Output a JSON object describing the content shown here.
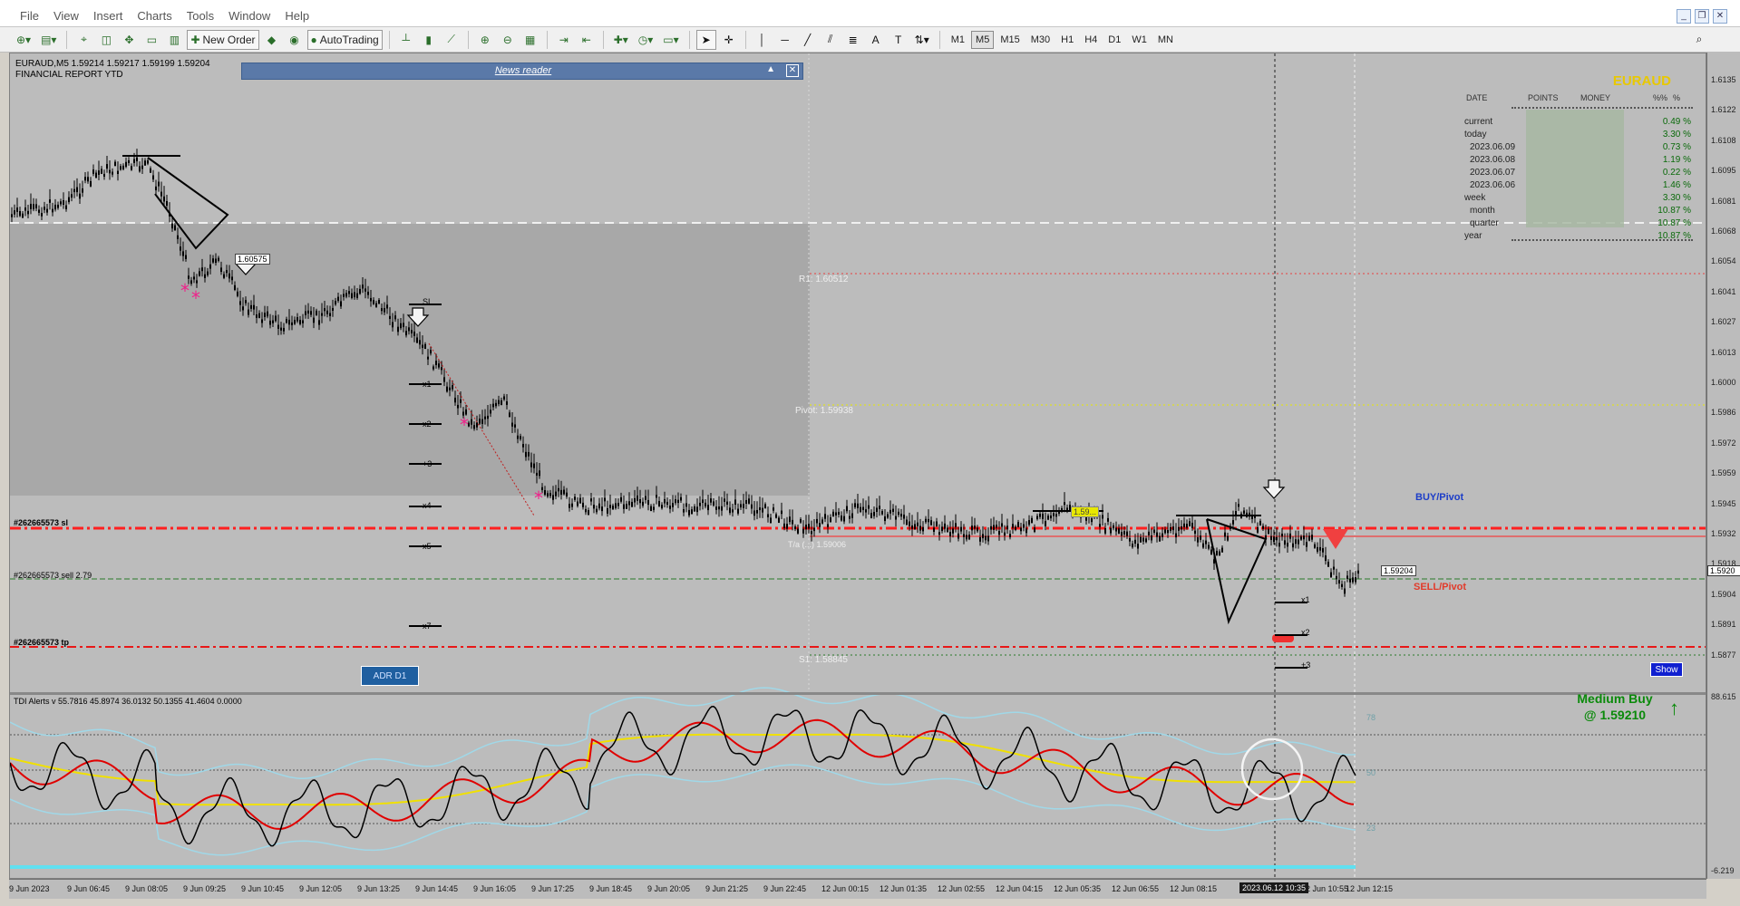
{
  "menu": [
    "File",
    "View",
    "Insert",
    "Charts",
    "Tools",
    "Window",
    "Help"
  ],
  "toolbar": {
    "new_order": "New Order",
    "autotrading": "AutoTrading",
    "timeframes": [
      "M1",
      "M5",
      "M15",
      "M30",
      "H1",
      "H4",
      "D1",
      "W1",
      "MN"
    ],
    "active_timeframe": "M5"
  },
  "chart": {
    "symbol_info": "EURAUD,M5 1.59214 1.59217 1.59199 1.59204",
    "report_title": "FINANCIAL REPORT YTD",
    "news_reader": "News reader",
    "levels": {
      "r1": "R1: 1.60512",
      "pivot": "Pivot: 1.59938",
      "s1": "S1: 1.58845",
      "ta_label": "T/a (...) 1.59006"
    },
    "orders": {
      "sl": "#262665573 sl",
      "sell": "#262665573 sell 2.79",
      "tp": "#262665573 tp"
    },
    "buy_pivot": "BUY/Pivot",
    "sell_pivot": "SELL/Pivot",
    "show_button": "Show",
    "adr_button": "ADR D1",
    "price_tags": {
      "left_box": "1.60575",
      "right_box": "1.59204",
      "yellow_box": "1.59..."
    },
    "steps": {
      "sl": "SL",
      "x1": "x1",
      "x2": "x2",
      "p3": "+3",
      "x4": "x4",
      "x5": "x5",
      "x7": "x7",
      "r_x1": "x1",
      "r_x2": "x2",
      "r_p3": "+3"
    }
  },
  "report": {
    "symbol": "EURAUD",
    "headers": [
      "DATE",
      "POINTS",
      "MONEY",
      "%%",
      "%"
    ],
    "rows": [
      {
        "label": "current",
        "pct": "0.49 %",
        "indent": false
      },
      {
        "label": "today",
        "pct": "3.30 %",
        "indent": false
      },
      {
        "label": "2023.06.09",
        "pct": "0.73 %",
        "indent": true
      },
      {
        "label": "2023.06.08",
        "pct": "1.19 %",
        "indent": true
      },
      {
        "label": "2023.06.07",
        "pct": "0.22 %",
        "indent": true
      },
      {
        "label": "2023.06.06",
        "pct": "1.46 %",
        "indent": true
      },
      {
        "label": "week",
        "pct": "3.30 %",
        "indent": false
      },
      {
        "label": "month",
        "pct": "10.87 %",
        "indent": true
      },
      {
        "label": "quarter",
        "pct": "10.87 %",
        "indent": true
      },
      {
        "label": "year",
        "pct": "10.87 %",
        "indent": false
      }
    ]
  },
  "price_axis": {
    "labels": [
      "1.6135",
      "1.6122",
      "1.6108",
      "1.6095",
      "1.6081",
      "1.6068",
      "1.6054",
      "1.6041",
      "1.6027",
      "1.6013",
      "1.6000",
      "1.5986",
      "1.5972",
      "1.5959",
      "1.5945",
      "1.5932",
      "1.5918",
      "1.5904",
      "1.5891",
      "1.5877"
    ],
    "current": "1.5920",
    "sub_top": "88.615",
    "sub_bottom": "-6.219"
  },
  "tdi": {
    "label": "TDI Alerts v 55.7816 45.8974 36.0132 50.1355 41.4604 0.0000",
    "levels": [
      "78",
      "50",
      "23"
    ],
    "signal_title": "Medium Buy",
    "signal_price": "@ 1.59210",
    "signal_arrow": "↑"
  },
  "time_axis": {
    "labels": [
      "9 Jun 2023",
      "9 Jun 06:45",
      "9 Jun 08:05",
      "9 Jun 09:25",
      "9 Jun 10:45",
      "9 Jun 12:05",
      "9 Jun 13:25",
      "9 Jun 14:45",
      "9 Jun 16:05",
      "9 Jun 17:25",
      "9 Jun 18:45",
      "9 Jun 20:05",
      "9 Jun 21:25",
      "9 Jun 22:45",
      "12 Jun 00:15",
      "12 Jun 01:35",
      "12 Jun 02:55",
      "12 Jun 04:15",
      "12 Jun 05:35",
      "12 Jun 06:55",
      "12 Jun 08:15",
      "12 Jun 10:55",
      "12 Jun 12:15"
    ],
    "cursor": "2023.06.12 10:35"
  },
  "colors": {
    "chart_bg": "#bcbcbc",
    "candles": "#000000",
    "sl_line": "#ff2020",
    "tp_line": "#e81818",
    "pivot_line": "#e8e800",
    "r1_line": "#ff4040",
    "tdi_red": "#e00000",
    "tdi_yellow": "#f0e000",
    "tdi_band": "#a0d8e8",
    "signal_green": "#0a8a0a"
  }
}
